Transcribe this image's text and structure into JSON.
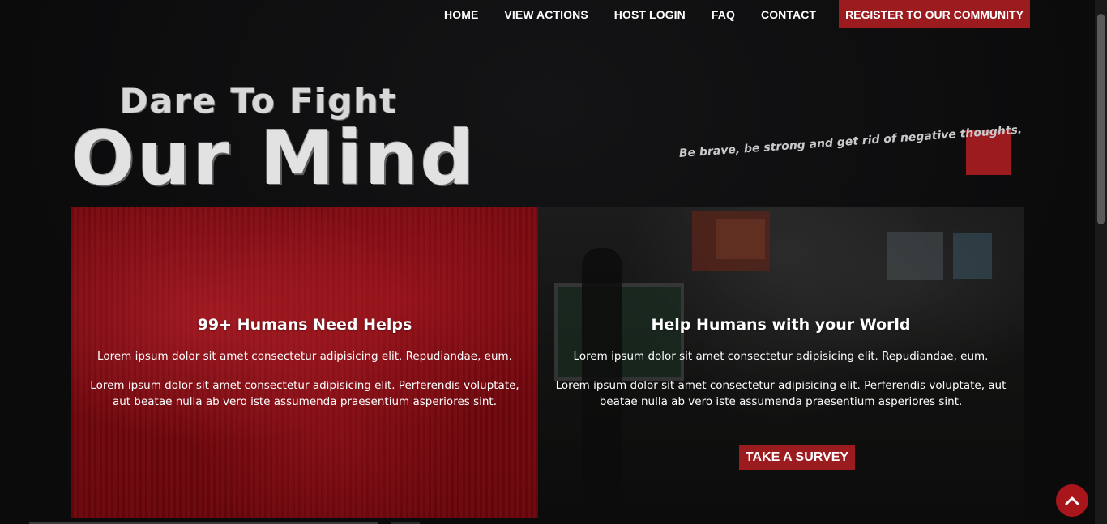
{
  "nav": {
    "items": [
      {
        "label": "HOME"
      },
      {
        "label": "VIEW ACTIONS"
      },
      {
        "label": "HOST LOGIN"
      },
      {
        "label": "FAQ"
      },
      {
        "label": "CONTACT"
      }
    ],
    "cta_label": "REGISTER TO OUR COMMUNITY"
  },
  "hero": {
    "line1": "Dare To Fight",
    "line2": "Our Mind",
    "tagline": "Be brave, be strong and get rid of negative thoughts."
  },
  "panels": [
    {
      "title": "99+ Humans Need Helps",
      "text1": "Lorem ipsum dolor sit amet consectetur adipisicing elit. Repudiandae, eum.",
      "text2": "Lorem ipsum dolor sit amet consectetur adipisicing elit. Perferendis voluptate, aut beatae nulla ab vero iste assumenda praesentium asperiores sint."
    },
    {
      "title": "Help Humans with your World",
      "text1": "Lorem ipsum dolor sit amet consectetur adipisicing elit. Repudiandae, eum.",
      "text2": "Lorem ipsum dolor sit amet consectetur adipisicing elit. Perferendis voluptate, aut beatae nulla ab vero iste assumenda praesentium asperiores sint.",
      "button_label": "TAKE A SURVEY"
    }
  ],
  "colors": {
    "accent": "#9b1b1f",
    "background": "#0c0c0d"
  },
  "icons": {
    "back_to_top": "chevron-up-icon"
  }
}
